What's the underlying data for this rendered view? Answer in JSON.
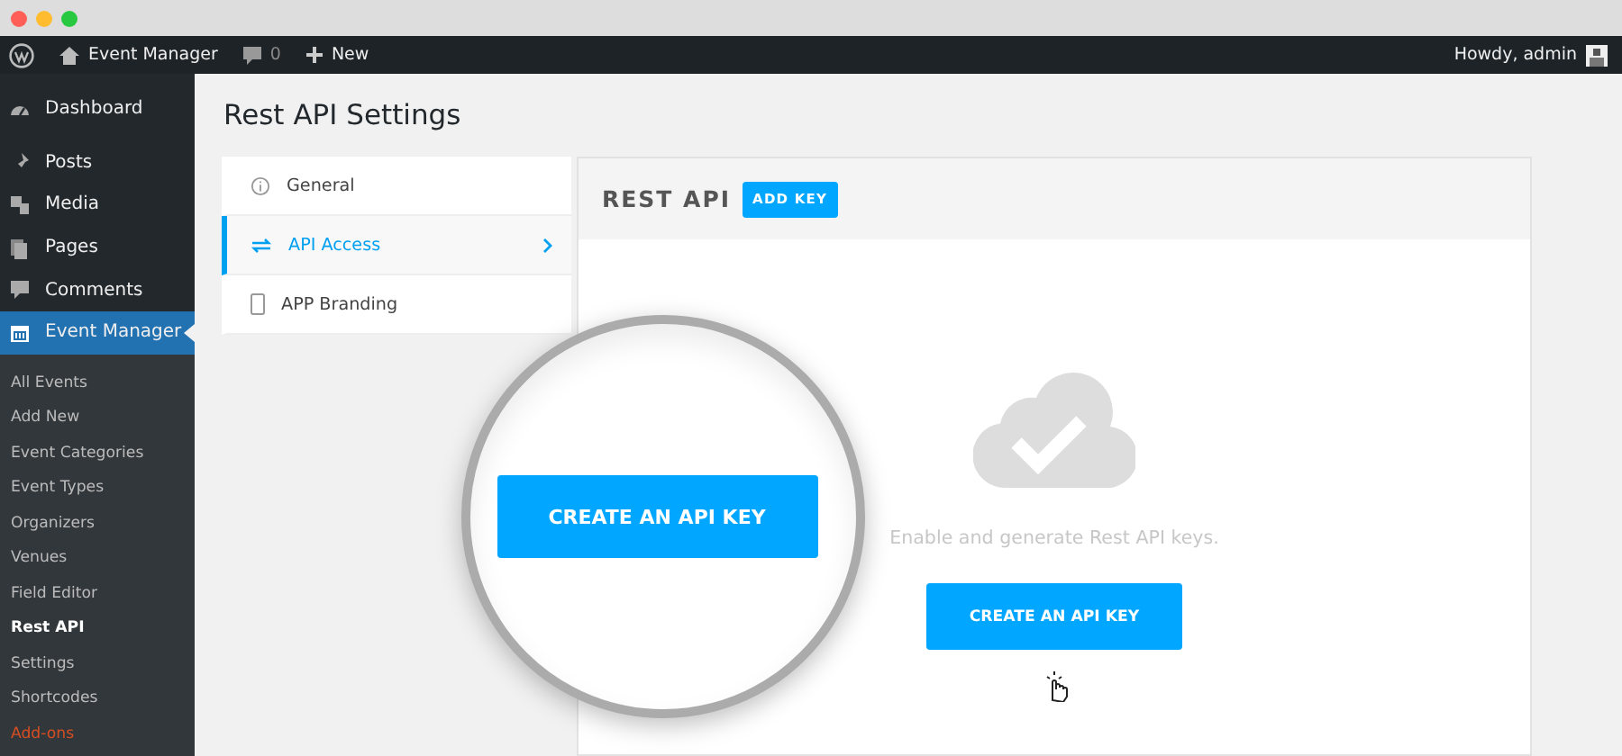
{
  "admin_bar": {
    "site": "Event Manager",
    "comments": "0",
    "new": "New",
    "greeting": "Howdy, admin"
  },
  "sidebar": {
    "items": [
      {
        "label": "Dashboard",
        "selected": false
      },
      {
        "label": "Posts",
        "selected": false
      },
      {
        "label": "Media",
        "selected": false
      },
      {
        "label": "Pages",
        "selected": false
      },
      {
        "label": "Comments",
        "selected": false
      },
      {
        "label": "Event Manager",
        "selected": true
      }
    ],
    "submenu": [
      {
        "label": "All Events",
        "selected": false,
        "kind": "link"
      },
      {
        "label": "Add New",
        "selected": false,
        "kind": "link"
      },
      {
        "label": "Event Categories",
        "selected": false,
        "kind": "link"
      },
      {
        "label": "Event Types",
        "selected": false,
        "kind": "link"
      },
      {
        "label": "Organizers",
        "selected": false,
        "kind": "link"
      },
      {
        "label": "Venues",
        "selected": false,
        "kind": "link"
      },
      {
        "label": "Field Editor",
        "selected": false,
        "kind": "link"
      },
      {
        "label": "Rest API",
        "selected": true,
        "kind": "link"
      },
      {
        "label": "Settings",
        "selected": false,
        "kind": "link"
      },
      {
        "label": "Shortcodes",
        "selected": false,
        "kind": "link"
      },
      {
        "label": "Add-ons",
        "selected": false,
        "kind": "addon"
      }
    ]
  },
  "page_title": "Rest API Settings",
  "tabs": [
    {
      "label": "General",
      "selected": false
    },
    {
      "label": "API Access",
      "selected": true
    },
    {
      "label": "APP Branding",
      "selected": false
    }
  ],
  "panel": {
    "title": "REST API",
    "add_button": "ADD KEY",
    "message": "Enable and generate Rest API keys.",
    "create_button": "CREATE AN API KEY"
  },
  "magnifier": {
    "button": "CREATE AN API KEY"
  }
}
